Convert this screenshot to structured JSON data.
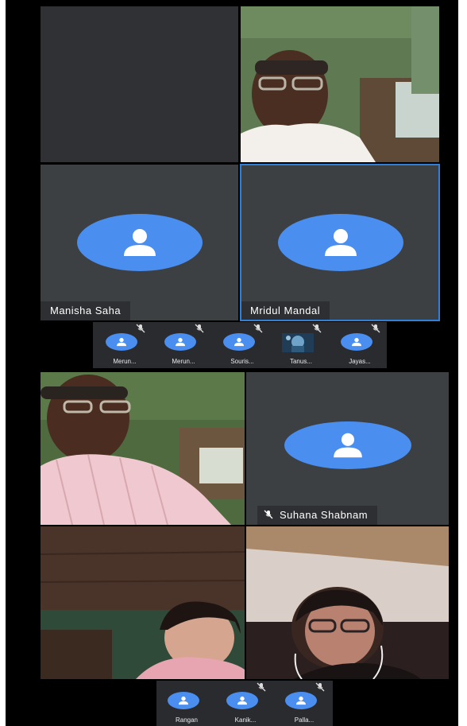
{
  "main_grid": {
    "tiles": [
      {
        "name": ""
      },
      {
        "name": ""
      },
      {
        "name": "Manisha Saha"
      },
      {
        "name": "Mridul Mandal"
      }
    ]
  },
  "top_strip": {
    "thumbs": [
      {
        "label": "Merun...",
        "muted": true
      },
      {
        "label": "Merun...",
        "muted": true
      },
      {
        "label": "Souris...",
        "muted": true
      },
      {
        "label": "Tanus...",
        "muted": true
      },
      {
        "label": "Jayas...",
        "muted": true
      }
    ]
  },
  "second_grid": {
    "tiles": [
      {
        "name": ""
      },
      {
        "name": "Suhana Shabnam",
        "muted": true
      },
      {
        "name": ""
      },
      {
        "name": ""
      }
    ]
  },
  "bottom_strip": {
    "thumbs": [
      {
        "label": "Rangan",
        "muted": false
      },
      {
        "label": "Kanik...",
        "muted": true
      },
      {
        "label": "Palla...",
        "muted": true
      }
    ]
  },
  "colors": {
    "avatar_blue": "#4a8ef0",
    "active_border": "#2f80d6",
    "tile_gray": "#3c4043"
  },
  "icons": {
    "avatar": "person-icon",
    "muted": "mic-off-icon"
  }
}
